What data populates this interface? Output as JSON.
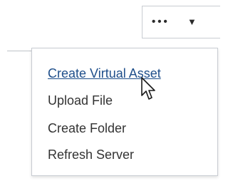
{
  "toolbar": {
    "more_icon": "more-horizontal-icon",
    "dropdown_icon": "caret-down-icon",
    "dots": "•••",
    "caret": "▼"
  },
  "menu": {
    "items": [
      {
        "label": "Create Virtual Asset",
        "state": "hovered"
      },
      {
        "label": "Upload File"
      },
      {
        "label": "Create Folder"
      },
      {
        "label": "Refresh Server"
      }
    ]
  },
  "colors": {
    "link_active": "#1f4f8b",
    "text": "#333333",
    "border": "#c8ccd2"
  }
}
